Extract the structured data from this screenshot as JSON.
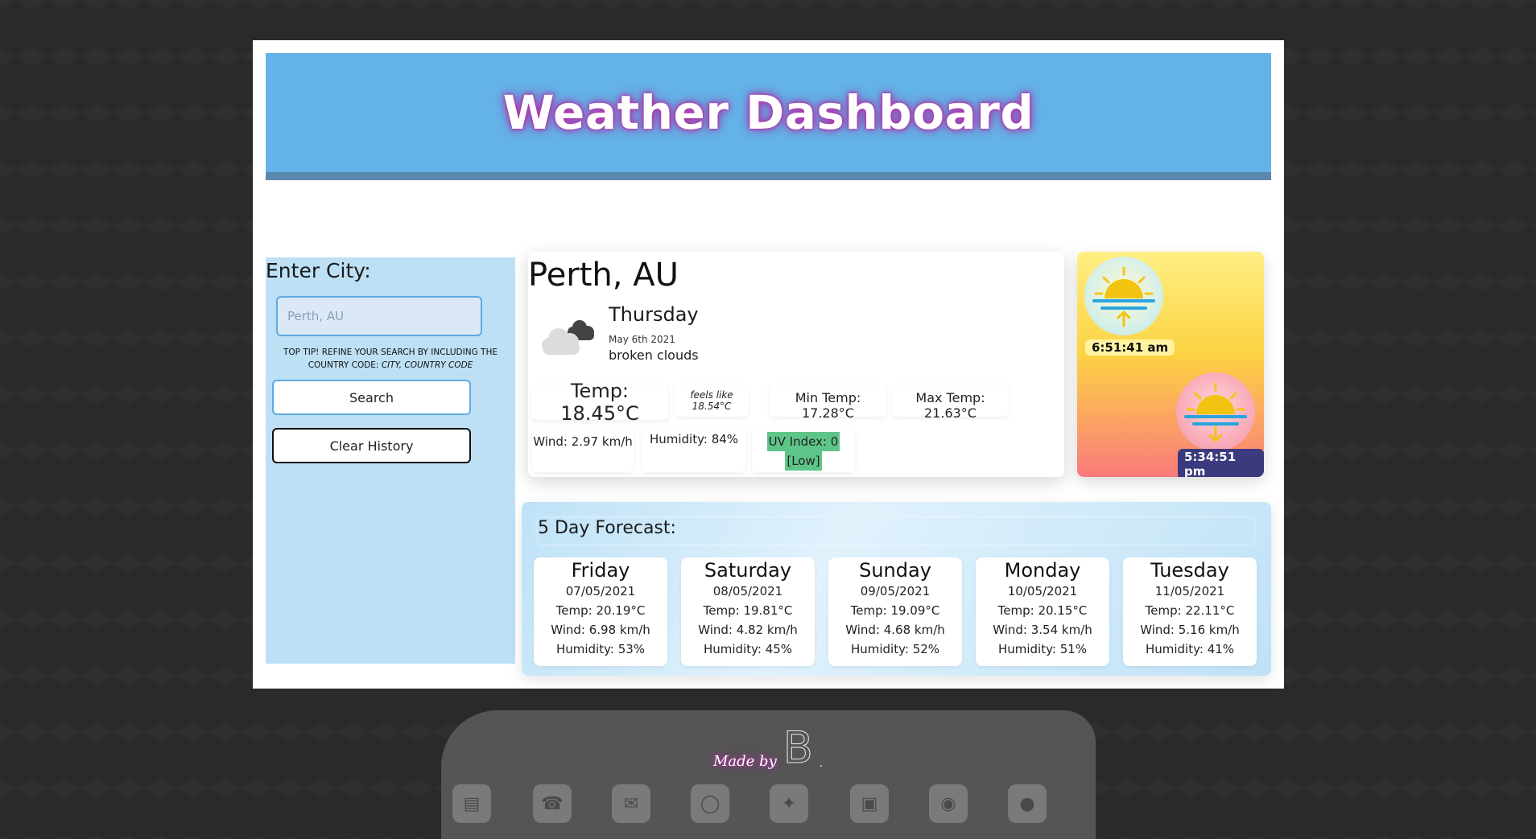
{
  "header": {
    "title": "Weather Dashboard"
  },
  "sidebar": {
    "enter_label": "Enter City:",
    "search_placeholder": "Perth, AU",
    "tip_text": "Top tip! Refine your search by including the country code:",
    "tip_example": "city, country code",
    "search_button": "Search",
    "clear_button": "Clear History"
  },
  "current": {
    "city": "Perth, AU",
    "day": "Thursday",
    "date": "May 6th 2021",
    "description": "broken clouds",
    "icon": "broken-clouds-icon",
    "temp": "Temp: 18.45°C",
    "feels_like": "feels like 18.54°C",
    "min_temp": "Min Temp: 17.28°C",
    "max_temp": "Max Temp: 21.63°C",
    "wind": "Wind: 2.97 km/h",
    "humidity": "Humidity: 84%",
    "uv_index": "UV Index: 0",
    "uv_level": "[Low]",
    "uv_color": "#5ec589"
  },
  "sun": {
    "sunrise_icon": "sunrise-icon",
    "sunrise": "6:51:41 am",
    "sunset_icon": "sunset-icon",
    "sunset": "5:34:51 pm"
  },
  "forecast": {
    "title": "5 Day Forecast:",
    "days": [
      {
        "day": "Friday",
        "date": "07/05/2021",
        "temp": "Temp: 20.19°C",
        "wind": "Wind: 6.98 km/h",
        "humidity": "Humidity: 53%"
      },
      {
        "day": "Saturday",
        "date": "08/05/2021",
        "temp": "Temp: 19.81°C",
        "wind": "Wind: 4.82 km/h",
        "humidity": "Humidity: 45%"
      },
      {
        "day": "Sunday",
        "date": "09/05/2021",
        "temp": "Temp: 19.09°C",
        "wind": "Wind: 4.68 km/h",
        "humidity": "Humidity: 52%"
      },
      {
        "day": "Monday",
        "date": "10/05/2021",
        "temp": "Temp: 20.15°C",
        "wind": "Wind: 3.54 km/h",
        "humidity": "Humidity: 51%"
      },
      {
        "day": "Tuesday",
        "date": "11/05/2021",
        "temp": "Temp: 22.11°C",
        "wind": "Wind: 5.16 km/h",
        "humidity": "Humidity: 41%"
      }
    ]
  },
  "footer": {
    "made_by": "Made by",
    "signature": "B",
    "signature_dot": ".",
    "social_icons": [
      "resume-icon",
      "phone-icon",
      "email-icon",
      "instagram-icon",
      "twitter-icon",
      "linkedin-icon",
      "github-icon",
      "portfolio-icon"
    ]
  },
  "colors": {
    "header_bg": "#63b3e8",
    "header_border": "#5c87ad",
    "sidebar_bg": "#bde0f5",
    "title_glow": "#c02fb1",
    "sunset_badge": "#3b3a7e",
    "sunrise_badge": "#fff3a0"
  }
}
